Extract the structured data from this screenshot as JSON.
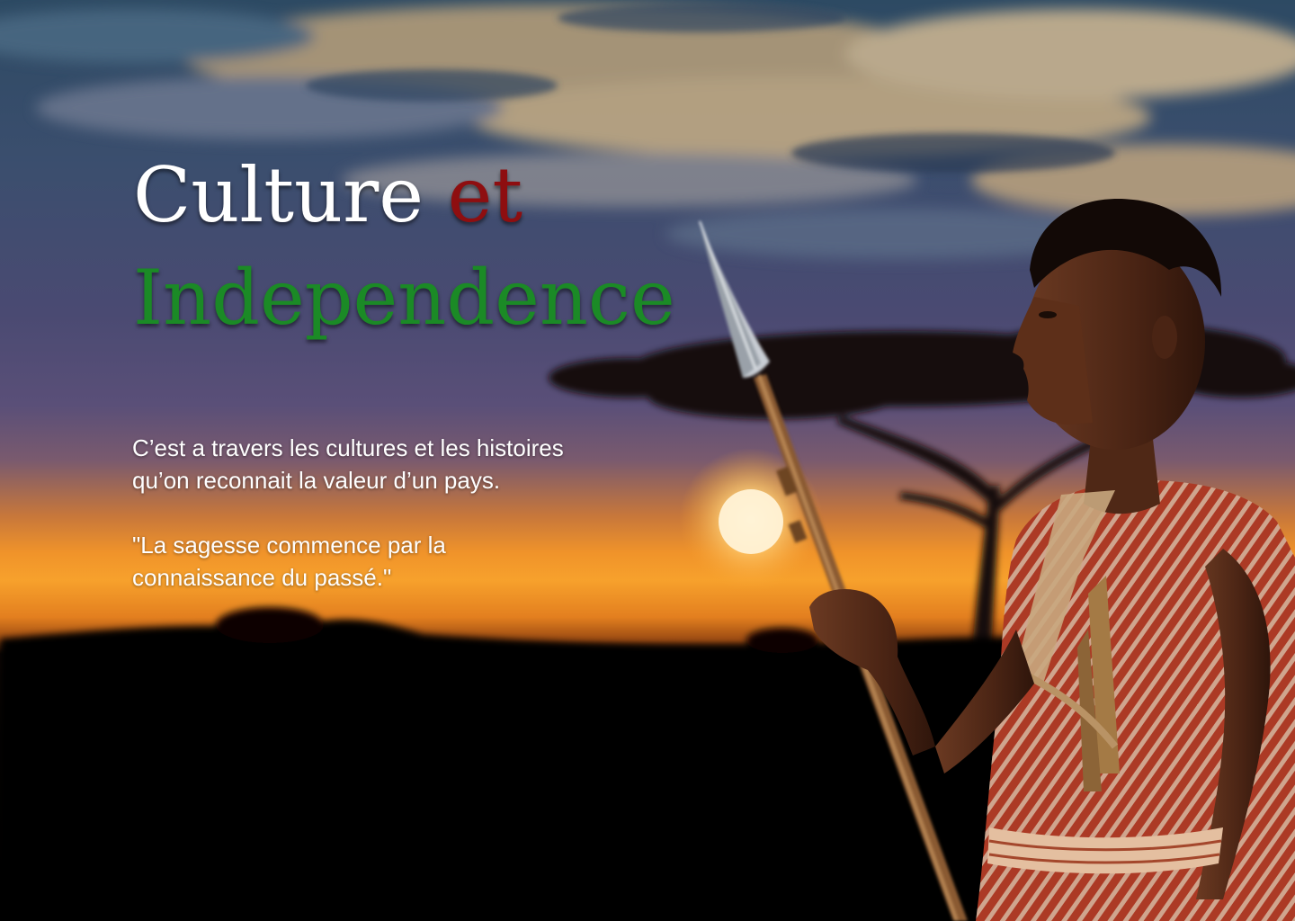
{
  "hero": {
    "title": {
      "word1": "Culture",
      "word2": "et",
      "word3": "Independence"
    },
    "paragraph_line1": "C’est a travers les cultures et les histoires",
    "paragraph_line2": "qu’on reconnait la valeur d’un pays.",
    "quote_line1": "\"La sagesse commence par la",
    "quote_line2": "connaissance du passé.\""
  },
  "colors": {
    "title_primary": "#ffffff",
    "title_accent_red": "#8e0e10",
    "title_accent_green": "#1b8a26",
    "body_text": "#ffffff"
  }
}
